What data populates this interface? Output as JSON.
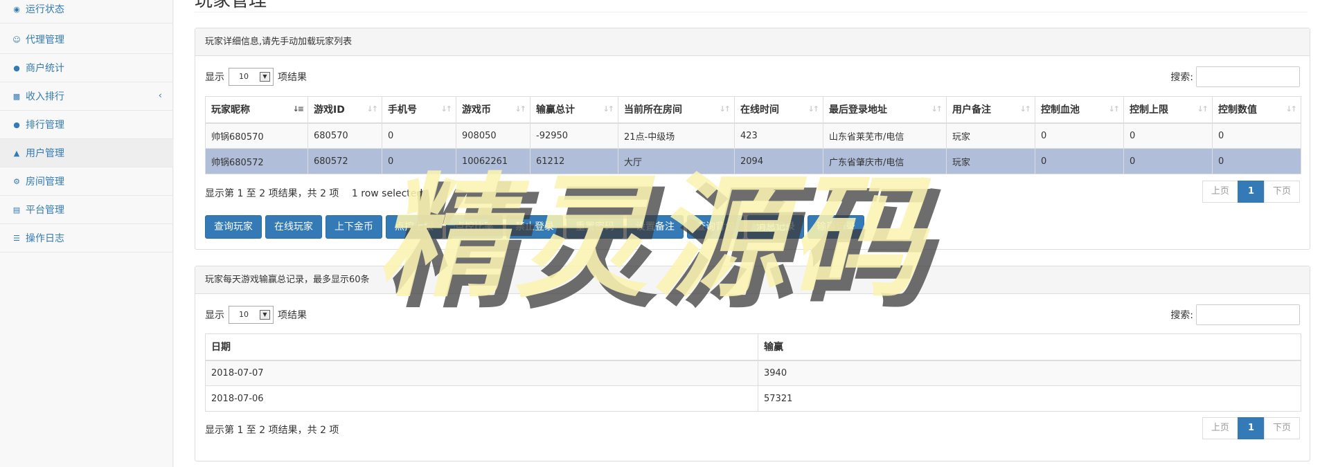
{
  "sidebar": {
    "items": [
      {
        "label": "运行状态",
        "icon": "dashboard-icon"
      },
      {
        "label": "代理管理",
        "icon": "smile-icon"
      },
      {
        "label": "商户统计",
        "icon": "users-icon"
      },
      {
        "label": "收入排行",
        "icon": "bar-chart-icon"
      },
      {
        "label": "排行管理",
        "icon": "users-icon"
      },
      {
        "label": "用户管理",
        "icon": "bell-icon"
      },
      {
        "label": "房间管理",
        "icon": "gear-icon"
      },
      {
        "label": "平台管理",
        "icon": "keyboard-icon"
      },
      {
        "label": "操作日志",
        "icon": "list-icon"
      }
    ]
  },
  "page": {
    "title": "玩家管理"
  },
  "players_panel": {
    "heading": "玩家详细信息,请先手动加载玩家列表",
    "length": {
      "show": "显示",
      "value": "10",
      "suffix": "项结果"
    },
    "search_label": "搜索:",
    "columns": [
      "玩家昵称",
      "游戏ID",
      "手机号",
      "游戏币",
      "输赢总计",
      "当前所在房间",
      "在线时间",
      "最后登录地址",
      "用户备注",
      "控制血池",
      "控制上限",
      "控制数值"
    ],
    "rows": [
      [
        "帅锅680570",
        "680570",
        "0",
        "908050",
        "-92950",
        "21点-中级场",
        "423",
        "山东省莱芜市/电信",
        "玩家",
        "0",
        "0",
        "0"
      ],
      [
        "帅锅680572",
        "680572",
        "0",
        "10062261",
        "61212",
        "大厅",
        "2094",
        "广东省肇庆市/电信",
        "玩家",
        "0",
        "0",
        "0"
      ]
    ],
    "info": "显示第 1 至 2 项结果，共 2 项",
    "selected_info": "1 row selected",
    "pagination": {
      "prev": "上页",
      "current": "1",
      "next": "下页"
    },
    "buttons": [
      "查询玩家",
      "在线玩家",
      "上下金币",
      "点控上限",
      "点控比率",
      "禁止登录",
      "重置密码",
      "设置备注",
      "查询背包",
      "消息记录",
      "输赢记录"
    ]
  },
  "daily_panel": {
    "heading": "玩家每天游戏输赢总记录，最多显示60条",
    "length": {
      "show": "显示",
      "value": "10",
      "suffix": "项结果"
    },
    "search_label": "搜索:",
    "columns": [
      "日期",
      "输赢"
    ],
    "rows": [
      [
        "2018-07-07",
        "3940"
      ],
      [
        "2018-07-06",
        "57321"
      ]
    ],
    "info": "显示第 1 至 2 项结果，共 2 项",
    "pagination": {
      "prev": "上页",
      "current": "1",
      "next": "下页"
    }
  },
  "watermark": {
    "text": "精灵源码"
  }
}
